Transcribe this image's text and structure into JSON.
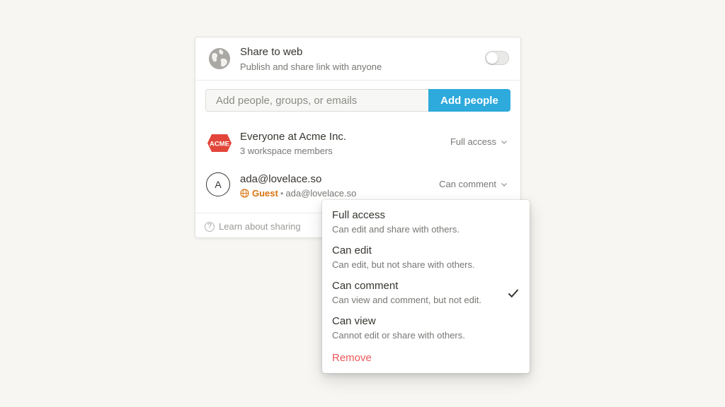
{
  "share_web": {
    "title": "Share to web",
    "subtitle": "Publish and share link with anyone",
    "toggle_on": false
  },
  "invite": {
    "placeholder": "Add people, groups, or emails",
    "button_label": "Add people"
  },
  "members": [
    {
      "name": "Everyone at Acme Inc.",
      "subtitle": "3 workspace members",
      "permission": "Full access",
      "logo_text": "ACME"
    },
    {
      "avatar_letter": "A",
      "name": "ada@lovelace.so",
      "badge": "Guest",
      "separator": "•",
      "email": "ada@lovelace.so",
      "permission": "Can comment"
    }
  ],
  "footer": {
    "help_label": "Learn about sharing",
    "help_icon_glyph": "?"
  },
  "permission_menu": {
    "options": [
      {
        "label": "Full access",
        "description": "Can edit and share with others.",
        "selected": false
      },
      {
        "label": "Can edit",
        "description": "Can edit, but not share with others.",
        "selected": false
      },
      {
        "label": "Can comment",
        "description": "Can view and comment, but not edit.",
        "selected": true
      },
      {
        "label": "Can view",
        "description": "Cannot edit or share with others.",
        "selected": false
      }
    ],
    "remove_label": "Remove"
  },
  "colors": {
    "accent": "#2eaadc",
    "guest": "#d9730d",
    "danger": "#eb5757",
    "acme_red": "#e2463a",
    "background": "#f7f6f3"
  },
  "icons": {
    "share_web": "globe-icon",
    "guest": "globe-small-icon",
    "permission": "chevron-down-icon",
    "selected": "check-icon",
    "help": "question-circle-icon"
  }
}
